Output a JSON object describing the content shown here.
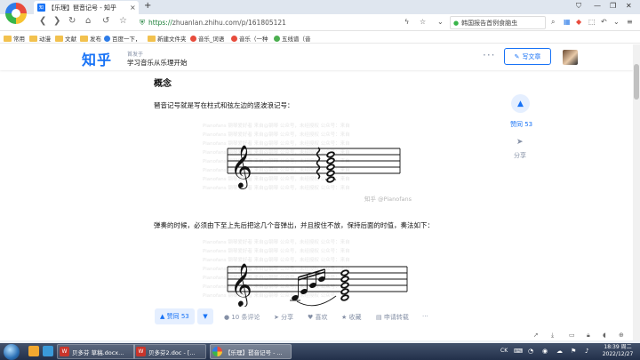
{
  "browser": {
    "tab_favicon": "知",
    "tab_title": "【乐理】琶音记号 - 知乎",
    "tab_close": "×",
    "new_tab": "+",
    "url_scheme": "https://",
    "url_rest": "zhuanlan.zhihu.com/p/161805121",
    "search_text": "韩国报告首例食脑虫",
    "icons": [
      "shield-icon",
      "lightning-icon",
      "star-icon",
      "dropdown-icon",
      "search-icon",
      "grid-icon",
      "gamepad-icon",
      "menu-icon"
    ]
  },
  "bookmarks": [
    {
      "label": "常用",
      "kind": "folder"
    },
    {
      "label": "动漫",
      "kind": "folder"
    },
    {
      "label": "文献",
      "kind": "folder"
    },
    {
      "label": "发布",
      "kind": "folder"
    },
    {
      "label": "百度一下，",
      "kind": "site"
    },
    {
      "label": "新建文件夹",
      "kind": "folder"
    },
    {
      "label": "音乐_词语",
      "kind": "site"
    },
    {
      "label": "音乐（一种",
      "kind": "site"
    },
    {
      "label": "五线谱（音",
      "kind": "site"
    }
  ],
  "zhihu": {
    "logo": "知乎",
    "column_label": "首发于",
    "column_name": "学习音乐从乐理开始",
    "more": "···",
    "write_button": "写文章"
  },
  "article": {
    "heading": "概念",
    "para1": "琶音记号就是写在柱式和弦左边的竖波浪记号：",
    "para2": "弹奏的时候，必须由下至上先后把这几个音弹出，并且按住不放，保持后面的时值，奏法如下：",
    "figure_caption": "知乎 @Pianofans",
    "watermark": "Pianofans 钢琴爱好者  来自@钢琴 公众号，未经授权  公众号：来自"
  },
  "right_rail": {
    "vote_label": "赞同 53",
    "share_label": "分享"
  },
  "action_bar": {
    "upvote": "▲ 赞同 53",
    "downvote": "▼",
    "comments": "10 条评论",
    "share": "分享",
    "like": "喜欢",
    "favorite": "收藏",
    "reprint": "申请转载",
    "more": "···"
  },
  "taskbar": {
    "tasks": [
      {
        "label": "贝多芬 草稿.docx...",
        "icon": "W"
      },
      {
        "label": "贝多芬2.doc - [...",
        "icon": "W"
      },
      {
        "label": "【乐理】琶音记号 - ...",
        "icon": ""
      }
    ],
    "tray_lang": "CK",
    "time": "18:39 周二",
    "date": "2022/12/27"
  }
}
